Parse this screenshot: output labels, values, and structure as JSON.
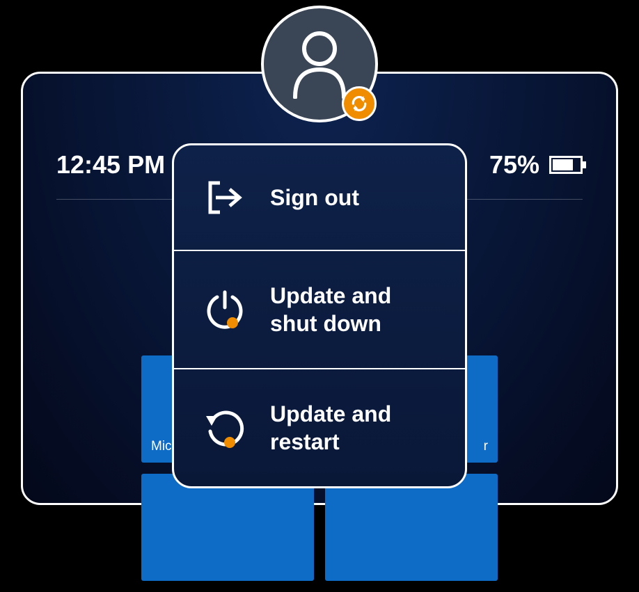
{
  "status": {
    "time": "12:45 PM",
    "battery_percent": "75%"
  },
  "tiles": {
    "left_label": "Mic",
    "right_label": "r"
  },
  "menu": {
    "signout_label": "Sign out",
    "update_shutdown_label": "Update and shut down",
    "update_restart_label": "Update and restart"
  },
  "colors": {
    "accent_orange": "#f08c00",
    "tile_blue": "#0e6cc7"
  }
}
